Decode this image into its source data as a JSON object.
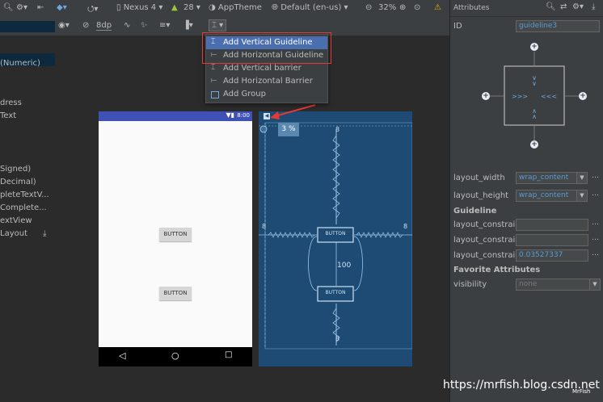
{
  "toolbar": {
    "device": "Nexus 4",
    "api": "28",
    "theme": "AppTheme",
    "locale": "Default (en-us)",
    "zoom": "32%",
    "margin": "8dp"
  },
  "guideline_menu": {
    "items": [
      {
        "label": "Add Vertical Guideline"
      },
      {
        "label": "Add Horizontal Guideline"
      },
      {
        "label": "Add Vertical barrier"
      },
      {
        "label": "Add Horizontal Barrier"
      },
      {
        "label": "Add Group"
      }
    ]
  },
  "palette": {
    "items": [
      "(Numeric)",
      "dress",
      "Text",
      "Signed)",
      "Decimal)",
      "pleteTextV...",
      "Complete...",
      "extView",
      "Layout"
    ]
  },
  "phone": {
    "time": "8:00",
    "button1": "BUTTON",
    "button2": "BUTTON"
  },
  "blueprint": {
    "guide_percent": "3 %",
    "margin_top": "8",
    "margin_bottom": "8",
    "margin_left": "8",
    "margin_right": "8",
    "gap": "100",
    "button1": "BUTTON",
    "button2": "BUTTON"
  },
  "attributes": {
    "title": "Attributes",
    "id_label": "ID",
    "id_value": "guideline3",
    "layout_width_label": "layout_width",
    "layout_width_value": "wrap_content",
    "layout_height_label": "layout_height",
    "layout_height_value": "wrap_content",
    "guideline_section": "Guideline",
    "constraint_label_1": "layout_constraint",
    "constraint_label_2": "layout_constraint",
    "constraint_label_3": "layout_constraint",
    "constraint_value_1": "",
    "constraint_value_2": "",
    "constraint_value_3": "0.03527337",
    "favorite_section": "Favorite Attributes",
    "visibility_label": "visibility",
    "visibility_value": "none"
  },
  "watermark": {
    "url": "https://mrfish.blog.csdn.net",
    "author": "MrFish"
  },
  "colors": {
    "accent": "#4b6eaf",
    "blueprint": "#1d4b73",
    "highlight_box": "#e53935",
    "app_bar": "#3f51b5",
    "warning": "#e8b400"
  }
}
